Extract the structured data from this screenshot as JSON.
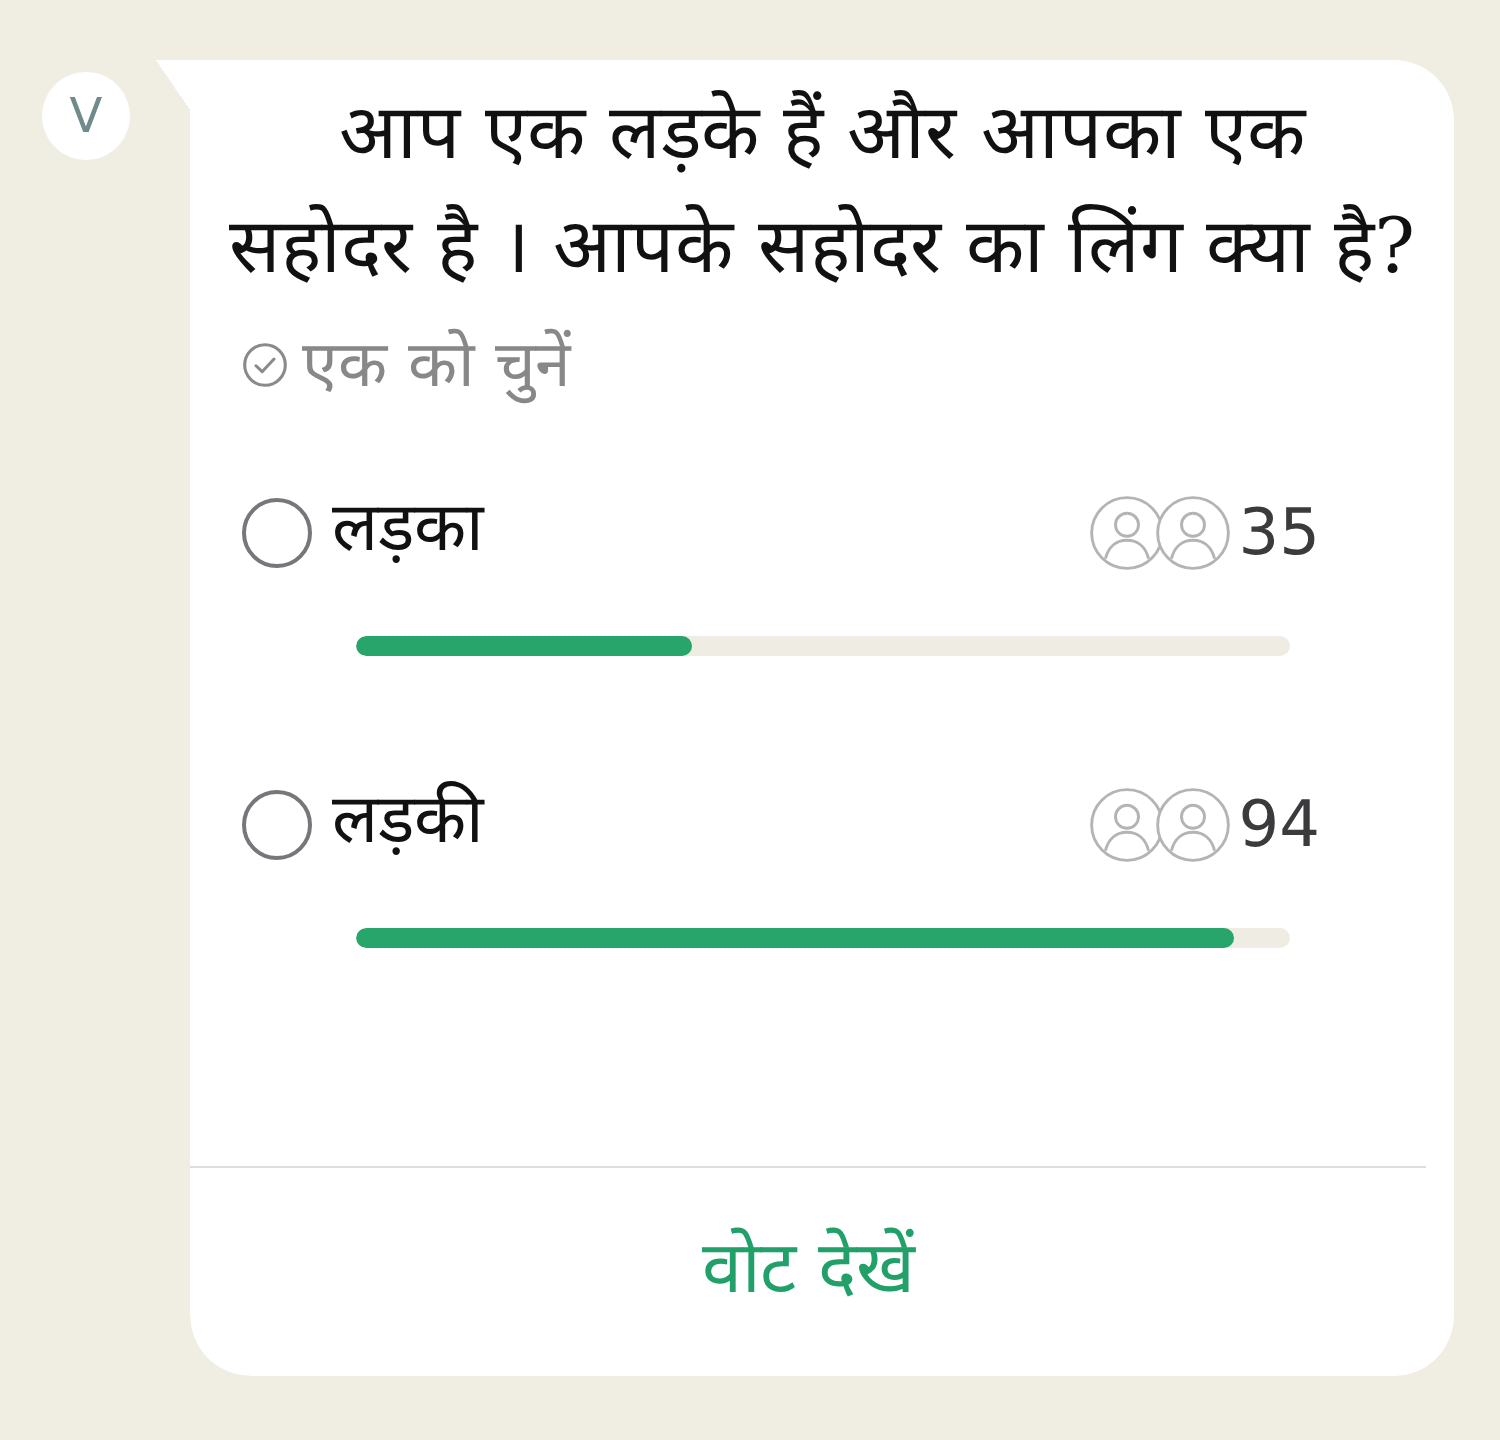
{
  "sender": {
    "initial": "V"
  },
  "poll": {
    "question_lines": [
      "आप एक लड़के हैं और आपका एक",
      "सहोदर है । आपके सहोदर का लिंग क्या है?"
    ],
    "hint": "एक को चुनें",
    "options": [
      {
        "label": "लड़का",
        "votes": "35",
        "level": 0.36,
        "selected": false
      },
      {
        "label": "लड़की",
        "votes": "94",
        "level": 0.94,
        "selected": false
      }
    ],
    "action": "वोट देखें"
  }
}
